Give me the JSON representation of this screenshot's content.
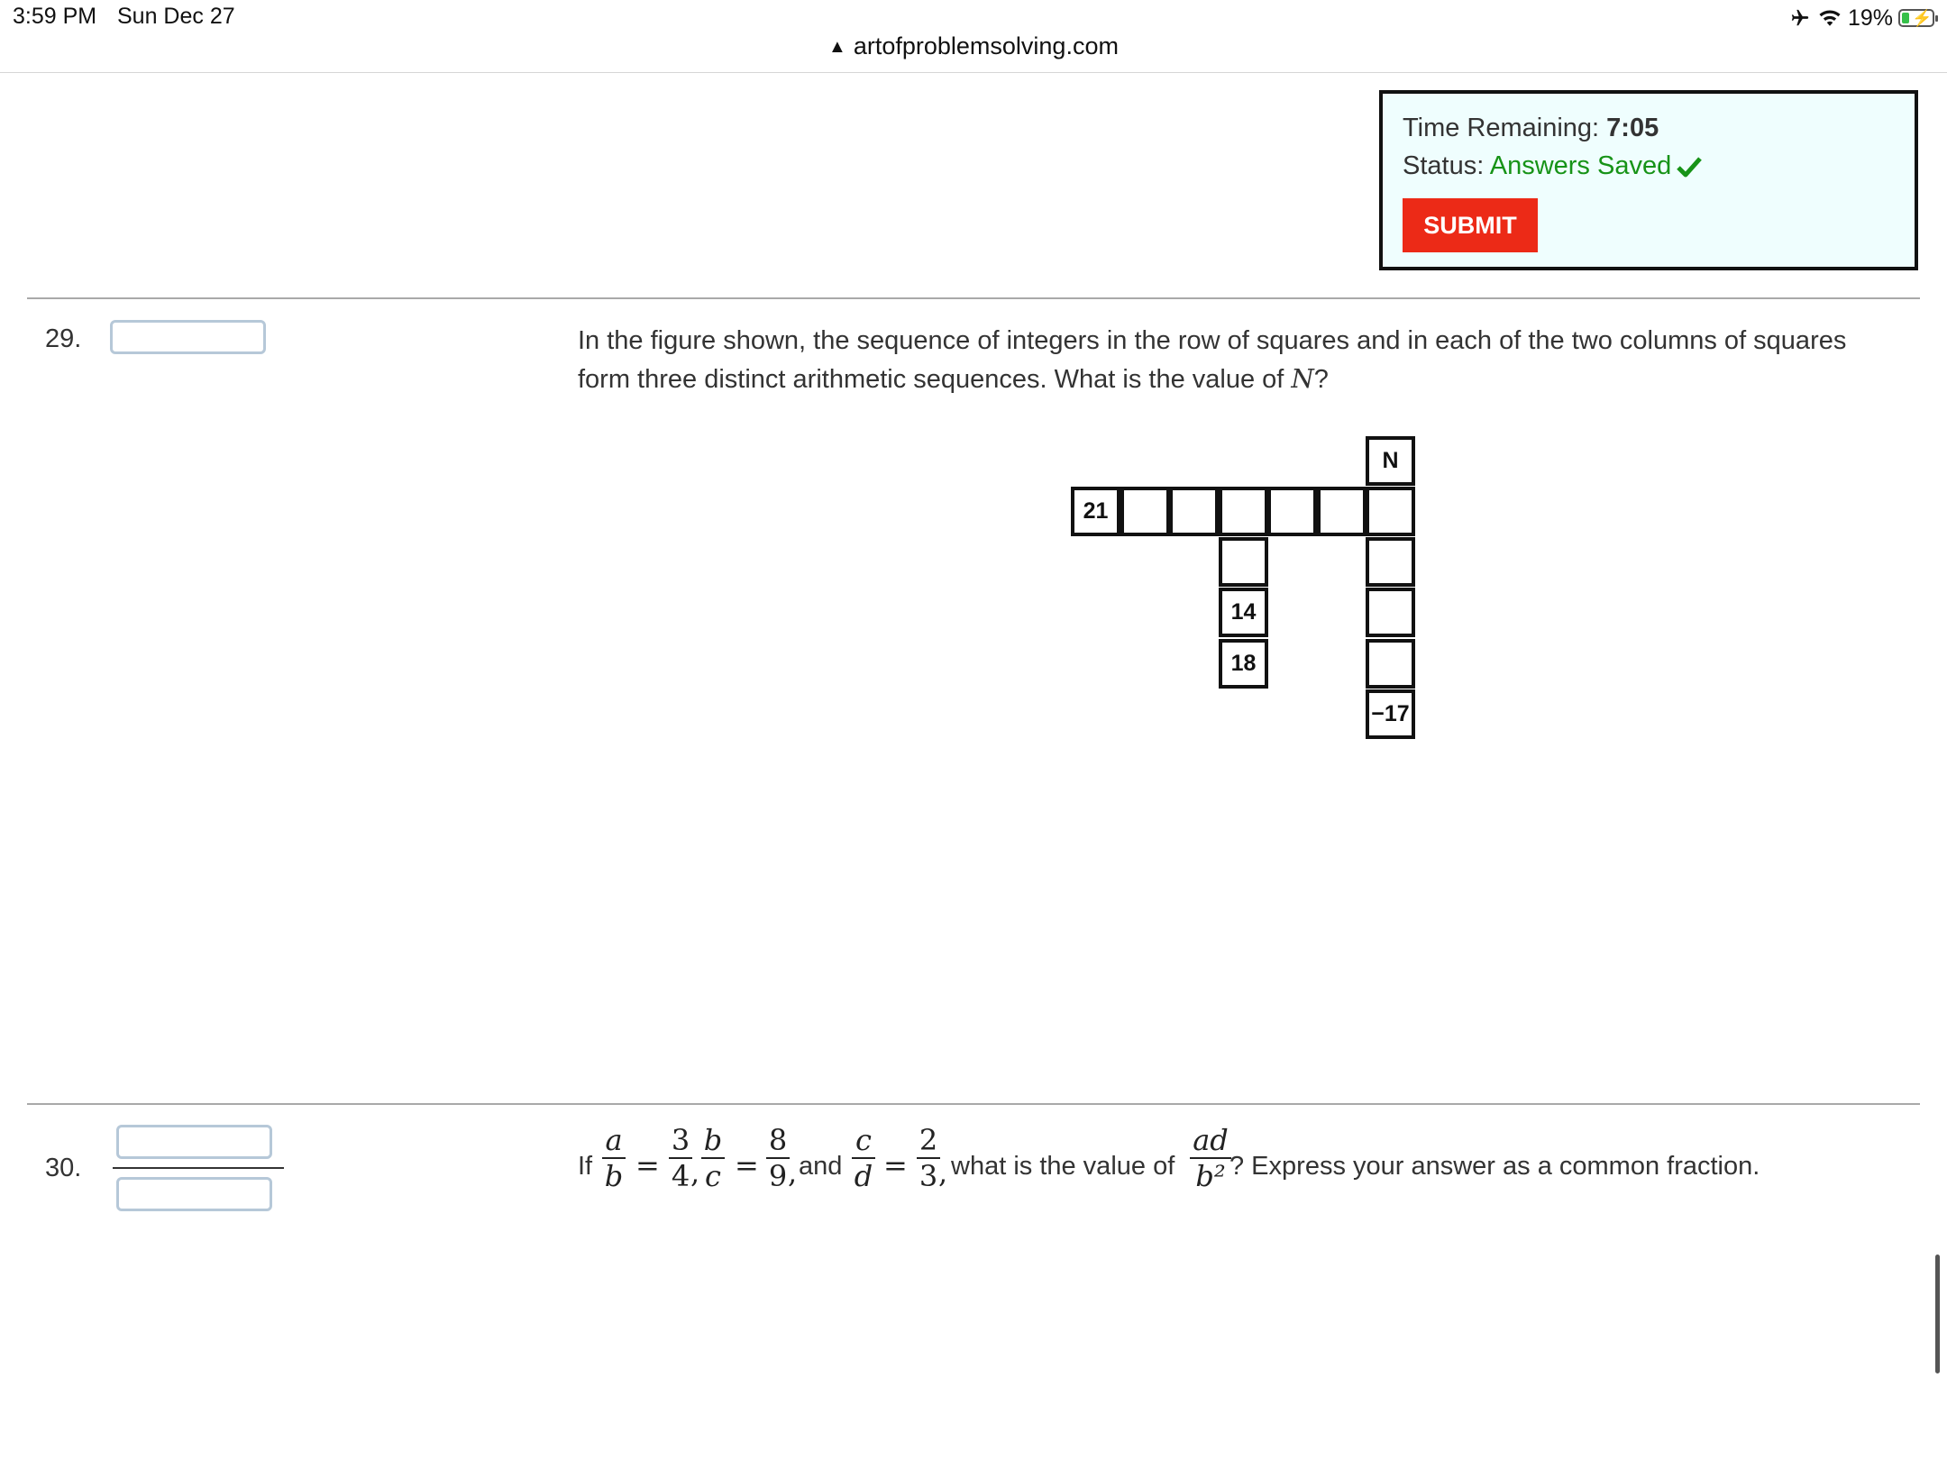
{
  "status_bar": {
    "time": "3:59 PM",
    "date": "Sun Dec 27",
    "battery": "19%",
    "airplane_icon": "airplane-icon",
    "wifi_icon": "wifi-icon"
  },
  "browser": {
    "url": "artofproblemsolving.com",
    "warning_icon": "warning-triangle-icon"
  },
  "timer": {
    "time_label": "Time Remaining: ",
    "time_value": "7:05",
    "status_label": "Status: ",
    "status_value": "Answers Saved",
    "submit_label": "SUBMIT",
    "colors": {
      "saved": "#179317",
      "submit_bg": "#ec2a17",
      "box_bg": "#effefe"
    }
  },
  "q29": {
    "number": "29.",
    "answer_value": "",
    "text_line1": "In the figure shown, the sequence of integers in the row of squares and in each of the two columns of squares",
    "text_line2_a": "form three distinct arithmetic sequences. What is the value of ",
    "text_var": "N",
    "text_line2_b": "?",
    "grid": {
      "top_label": "N",
      "row_start": "21",
      "col1_a": "14",
      "col1_b": "18",
      "col2_end": "−17"
    }
  },
  "q30": {
    "number": "30.",
    "numerator_value": "",
    "denominator_value": "",
    "if": "If",
    "and": "and",
    "what": "what is the value of",
    "express": "? Express your answer as a common fraction.",
    "fracs": {
      "a_b": {
        "num": "a",
        "den": "b"
      },
      "3_4": {
        "num": "3",
        "den": "4"
      },
      "b_c": {
        "num": "b",
        "den": "c"
      },
      "8_9": {
        "num": "8",
        "den": "9"
      },
      "c_d": {
        "num": "c",
        "den": "d"
      },
      "2_3": {
        "num": "2",
        "den": "3"
      },
      "ad_b2": {
        "num": "ad",
        "den": "b²"
      }
    }
  }
}
